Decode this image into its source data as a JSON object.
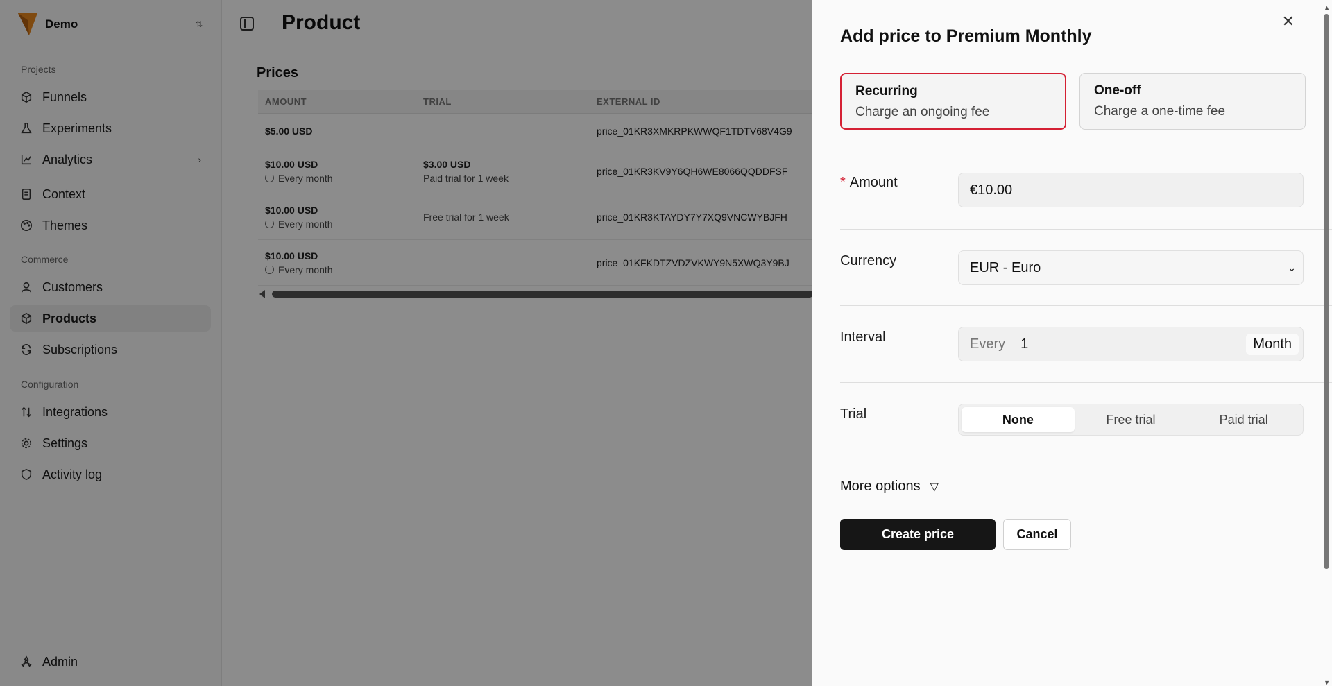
{
  "org": {
    "name": "Demo"
  },
  "sidebar": {
    "sections": [
      "Projects",
      "Commerce",
      "Configuration"
    ],
    "items": [
      {
        "label": "Funnels",
        "icon": "cube-icon"
      },
      {
        "label": "Experiments",
        "icon": "flask-icon"
      },
      {
        "label": "Analytics",
        "icon": "chart-icon"
      },
      {
        "label": "Context",
        "icon": "document-icon"
      },
      {
        "label": "Themes",
        "icon": "palette-icon"
      },
      {
        "label": "Customers",
        "icon": "user-icon"
      },
      {
        "label": "Products",
        "icon": "box-icon"
      },
      {
        "label": "Subscriptions",
        "icon": "refresh-icon"
      },
      {
        "label": "Integrations",
        "icon": "arrows-icon"
      },
      {
        "label": "Settings",
        "icon": "gear-icon"
      },
      {
        "label": "Activity log",
        "icon": "shield-icon"
      }
    ],
    "admin": "Admin",
    "active": "Products"
  },
  "main": {
    "title": "Product",
    "prices_heading": "Prices",
    "columns": [
      "AMOUNT",
      "TRIAL",
      "EXTERNAL ID"
    ],
    "rows": [
      {
        "amount": "$5.00 USD",
        "interval": "",
        "trial_amount": "",
        "trial": "",
        "external_id": "price_01KR3XMKRPKWWQF1TDTV68V4G9"
      },
      {
        "amount": "$10.00 USD",
        "interval": "Every month",
        "trial_amount": "$3.00 USD",
        "trial": "Paid trial for 1 week",
        "external_id": "price_01KR3KV9Y6QH6WE8066QQDDFSF"
      },
      {
        "amount": "$10.00 USD",
        "interval": "Every month",
        "trial_amount": "",
        "trial": "Free trial for 1 week",
        "external_id": "price_01KR3KTAYDY7Y7XQ9VNCWYBJFH"
      },
      {
        "amount": "$10.00 USD",
        "interval": "Every month",
        "trial_amount": "",
        "trial": "",
        "external_id": "price_01KFKDTZVDZVKWY9N5XWQ3Y9BJ"
      }
    ]
  },
  "drawer": {
    "title": "Add price to Premium Monthly",
    "types": [
      {
        "title": "Recurring",
        "desc": "Charge an ongoing fee",
        "selected": true
      },
      {
        "title": "One-off",
        "desc": "Charge a one-time fee",
        "selected": false
      }
    ],
    "amount_label": "Amount",
    "amount_value": "€10.00",
    "currency_label": "Currency",
    "currency_value": "EUR - Euro",
    "interval_label": "Interval",
    "interval_prefix": "Every",
    "interval_count": "1",
    "interval_unit": "Month",
    "trial_label": "Trial",
    "trial_options": [
      "None",
      "Free trial",
      "Paid trial"
    ],
    "trial_selected": "None",
    "more_options": "More options",
    "create_label": "Create price",
    "cancel_label": "Cancel"
  },
  "colors": {
    "accent_red": "#d42033",
    "primary_button": "#161616",
    "logo_orange": "#e8871e"
  }
}
